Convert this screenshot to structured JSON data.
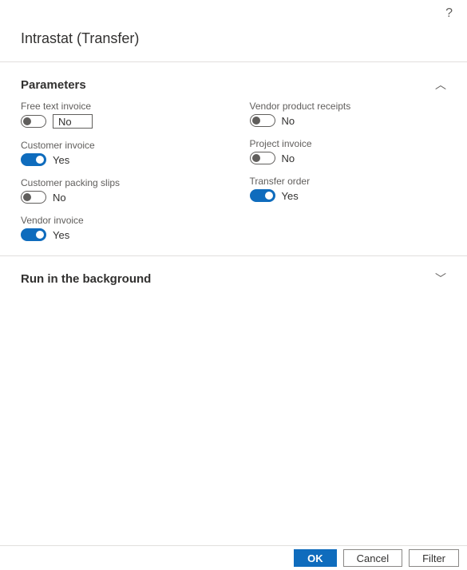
{
  "helpIcon": "?",
  "title": "Intrastat (Transfer)",
  "sections": {
    "parameters": {
      "title": "Parameters",
      "expanded": true,
      "chevron": "︿",
      "fields": {
        "freeTextInvoice": {
          "label": "Free text invoice",
          "value": "No",
          "on": false
        },
        "customerInvoice": {
          "label": "Customer invoice",
          "value": "Yes",
          "on": true
        },
        "customerPackingSlips": {
          "label": "Customer packing slips",
          "value": "No",
          "on": false
        },
        "vendorInvoice": {
          "label": "Vendor invoice",
          "value": "Yes",
          "on": true
        },
        "vendorProductReceipts": {
          "label": "Vendor product receipts",
          "value": "No",
          "on": false
        },
        "projectInvoice": {
          "label": "Project invoice",
          "value": "No",
          "on": false
        },
        "transferOrder": {
          "label": "Transfer order",
          "value": "Yes",
          "on": true
        }
      }
    },
    "runInBackground": {
      "title": "Run in the background",
      "expanded": false,
      "chevron": "﹀"
    }
  },
  "footer": {
    "ok": "OK",
    "cancel": "Cancel",
    "filter": "Filter"
  }
}
